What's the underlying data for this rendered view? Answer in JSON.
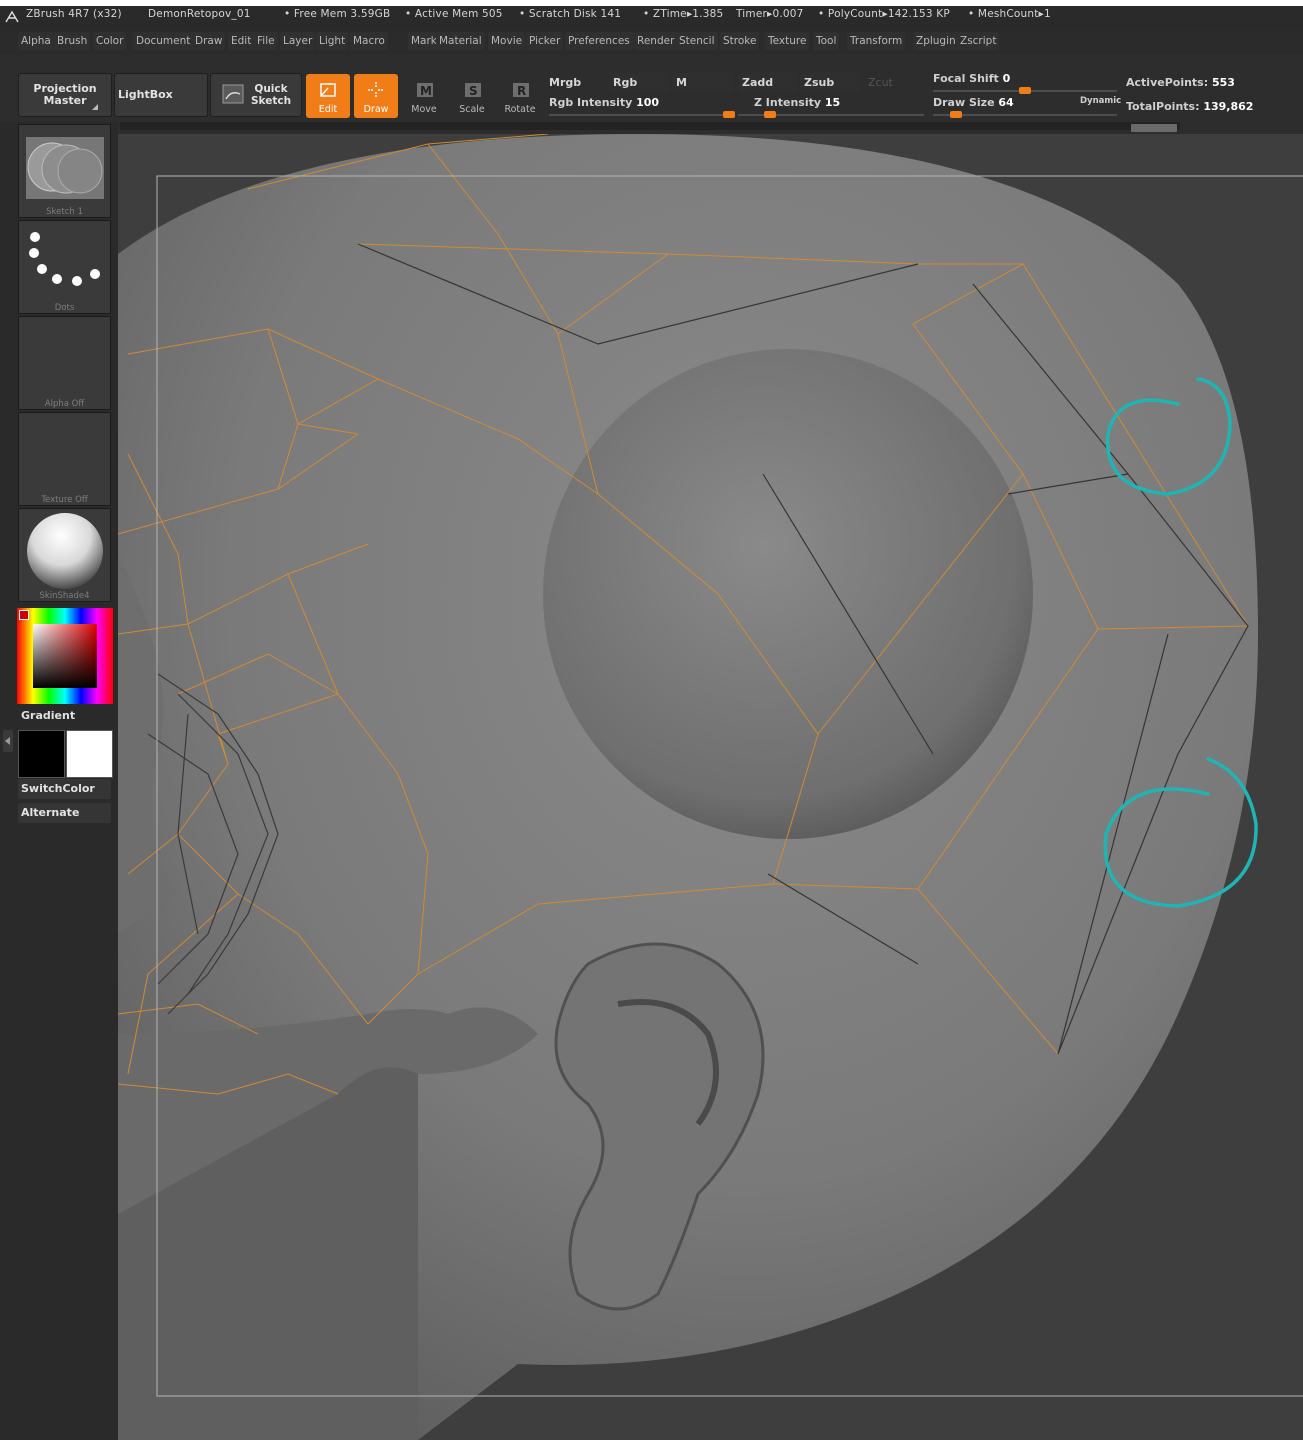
{
  "titlebar": {
    "app": "ZBrush 4R7 (x32)",
    "document": "DemonRetopov_01",
    "free_mem": "• Free Mem 3.59GB",
    "active_mem": "• Active Mem 505",
    "scratch_disk": "• Scratch Disk 141",
    "ztime": "• ZTime▸1.385",
    "timer": "Timer▸0.007",
    "polycount": "• PolyCount▸142.153 KP",
    "meshcount": "• MeshCount▸1"
  },
  "menu": [
    "Alpha",
    "Brush",
    "Color",
    "Document",
    "Draw",
    "Edit",
    "File",
    "Layer",
    "Light",
    "Macro",
    "Marker",
    "Material",
    "Movie",
    "Picker",
    "Preferences",
    "Render",
    "Stencil",
    "Stroke",
    "Texture",
    "Tool",
    "Transform",
    "Zplugin",
    "Zscript"
  ],
  "shelf": {
    "projection_master": "Projection Master",
    "lightbox": "LightBox",
    "quick_sketch": "Quick Sketch",
    "edit": "Edit",
    "draw": "Draw",
    "move": "Move",
    "scale": "Scale",
    "rotate": "Rotate",
    "mrgb": "Mrgb",
    "rgb": "Rgb",
    "m": "M",
    "rgb_intensity_label": "Rgb Intensity",
    "rgb_intensity_value": "100",
    "zadd": "Zadd",
    "zsub": "Zsub",
    "zcut": "Zcut",
    "z_intensity_label": "Z Intensity",
    "z_intensity_value": "15",
    "focal_shift_label": "Focal Shift",
    "focal_shift_value": "0",
    "draw_size_label": "Draw Size",
    "draw_size_value": "64",
    "dynamic": "Dynamic",
    "active_points_label": "ActivePoints:",
    "active_points_value": "553",
    "total_points_label": "TotalPoints:",
    "total_points_value": "139,862",
    "rgb_intensity_fraction": 1.0,
    "z_intensity_fraction": 0.15,
    "focal_shift_fraction": 0.5,
    "draw_size_fraction": 0.1
  },
  "left": {
    "brush_caption": "Sketch 1",
    "stroke_caption": "Dots",
    "alpha_caption": "Alpha Off",
    "texture_caption": "Texture Off",
    "material_caption": "SkinShade4",
    "gradient": "Gradient",
    "switch_color": "SwitchColor",
    "alternate": "Alternate",
    "main_color": "#000000",
    "secondary_color": "#ffffff"
  },
  "colors": {
    "accent": "#f07d18",
    "annotation": "#1fb5b5"
  }
}
